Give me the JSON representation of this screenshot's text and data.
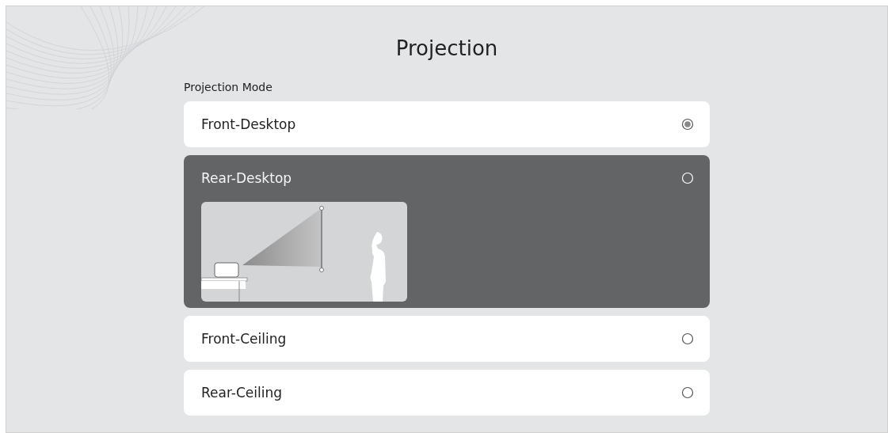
{
  "title": "Projection",
  "section": {
    "label": "Projection Mode"
  },
  "options": [
    {
      "label": "Front-Desktop",
      "selected": true,
      "focused": false
    },
    {
      "label": "Rear-Desktop",
      "selected": false,
      "focused": true
    },
    {
      "label": "Front-Ceiling",
      "selected": false,
      "focused": false
    },
    {
      "label": "Rear-Ceiling",
      "selected": false,
      "focused": false
    }
  ]
}
